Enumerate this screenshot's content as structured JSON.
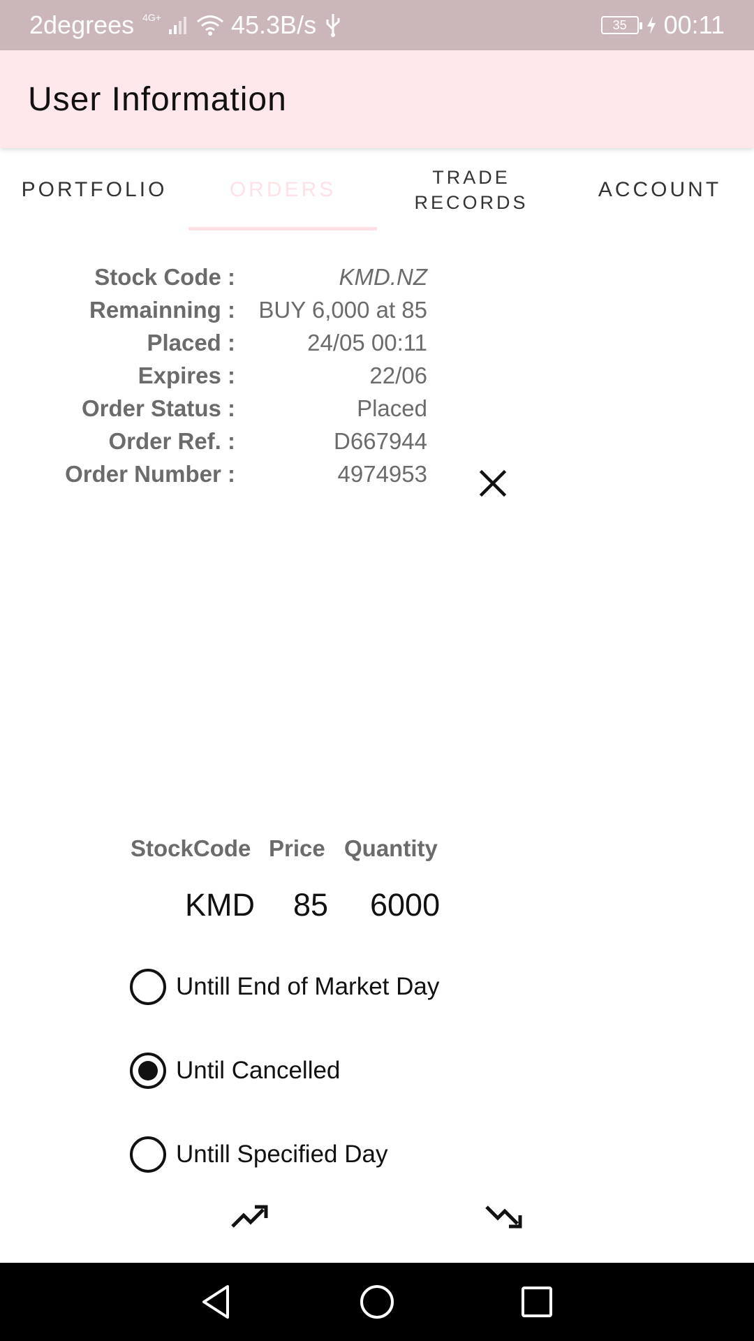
{
  "status_bar": {
    "carrier": "2degrees",
    "network_type": "4G+",
    "speed": "45.3B/s",
    "battery": "35",
    "time": "00:11"
  },
  "app_bar": {
    "title": "User Information"
  },
  "tabs": [
    {
      "label": "PORTFOLIO",
      "active": false
    },
    {
      "label": "ORDERS",
      "active": true
    },
    {
      "label": "TRADE\nRECORDS",
      "active": false
    },
    {
      "label": "ACCOUNT",
      "active": false
    }
  ],
  "order": {
    "stock_code_label": "Stock Code :",
    "stock_code": "KMD.NZ",
    "remaining_label": "Remainning :",
    "remaining": "BUY 6,000 at 85",
    "placed_label": "Placed :",
    "placed": "24/05 00:11",
    "expires_label": "Expires :",
    "expires": "22/06",
    "status_label": "Order Status :",
    "status": "Placed",
    "ref_label": "Order Ref. :",
    "ref": "D667944",
    "number_label": "Order Number :",
    "number": "4974953"
  },
  "form": {
    "headers": {
      "stock_code": "StockCode",
      "price": "Price",
      "quantity": "Quantity"
    },
    "values": {
      "stock_code": "KMD",
      "price": "85",
      "quantity": "6000"
    },
    "options": [
      {
        "label": "Untill End of Market Day",
        "selected": false
      },
      {
        "label": "Until Cancelled",
        "selected": true
      },
      {
        "label": "Untill Specified Day",
        "selected": false
      }
    ]
  },
  "icons": {
    "close": "close-icon",
    "buy": "trending-up-icon",
    "sell": "trending-down-icon"
  },
  "colors": {
    "status_bar": "#cbb6b9",
    "app_bar": "#ffe8ec",
    "active_tab": "#ffe0e6"
  }
}
